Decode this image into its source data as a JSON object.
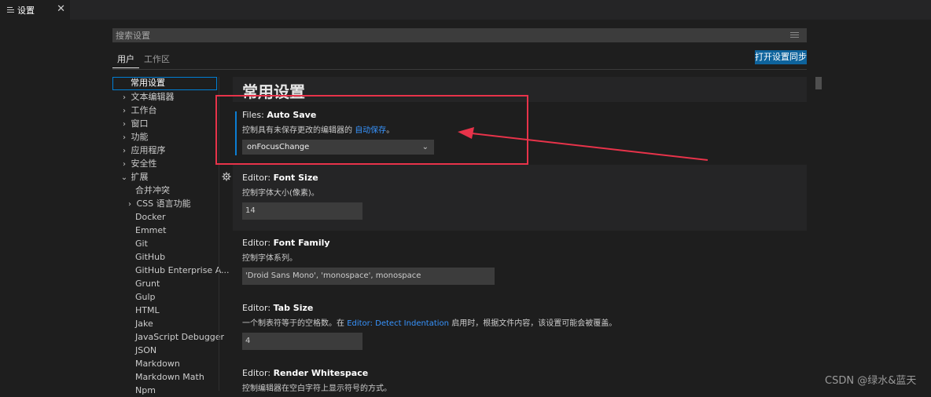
{
  "tab": {
    "title": "设置",
    "icon": "settings-list-icon",
    "close": "✕"
  },
  "search": {
    "placeholder": "搜索设置",
    "filter_icon": "filter-list-icon"
  },
  "scope_tabs": [
    "用户",
    "工作区"
  ],
  "sync_button": "打开设置同步",
  "toc": [
    {
      "label": "常用设置",
      "selected": true
    },
    {
      "label": "文本编辑器",
      "chevron": "›"
    },
    {
      "label": "工作台",
      "chevron": "›"
    },
    {
      "label": "窗口",
      "chevron": "›"
    },
    {
      "label": "功能",
      "chevron": "›"
    },
    {
      "label": "应用程序",
      "chevron": "›"
    },
    {
      "label": "安全性",
      "chevron": "›"
    },
    {
      "label": "扩展",
      "chevron": "⌄"
    },
    {
      "label": "合并冲突"
    },
    {
      "label": "CSS 语言功能",
      "chevron": "›"
    },
    {
      "label": "Docker"
    },
    {
      "label": "Emmet"
    },
    {
      "label": "Git"
    },
    {
      "label": "GitHub"
    },
    {
      "label": "GitHub Enterprise A..."
    },
    {
      "label": "Grunt"
    },
    {
      "label": "Gulp"
    },
    {
      "label": "HTML"
    },
    {
      "label": "Jake"
    },
    {
      "label": "JavaScript Debugger"
    },
    {
      "label": "JSON"
    },
    {
      "label": "Markdown"
    },
    {
      "label": "Markdown Math"
    },
    {
      "label": "Npm"
    }
  ],
  "section_title": "常用设置",
  "settings": {
    "auto_save": {
      "category": "Files:",
      "name": "Auto Save",
      "desc_prefix": "控制具有未保存更改的编辑器的",
      "desc_link": "自动保存",
      "desc_suffix": "。",
      "value": "onFocusChange"
    },
    "font_size": {
      "category": "Editor:",
      "name": "Font Size",
      "desc": "控制字体大小(像素)。",
      "value": "14"
    },
    "font_family": {
      "category": "Editor:",
      "name": "Font Family",
      "desc": "控制字体系列。",
      "value": "'Droid Sans Mono', 'monospace', monospace"
    },
    "tab_size": {
      "category": "Editor:",
      "name": "Tab Size",
      "desc_prefix": "一个制表符等于的空格数。在",
      "desc_link": "Editor: Detect Indentation",
      "desc_suffix": "启用时，根据文件内容，该设置可能会被覆盖。",
      "value": "4"
    },
    "render_whitespace": {
      "category": "Editor:",
      "name": "Render Whitespace",
      "desc": "控制编辑器在空白字符上显示符号的方式。"
    }
  },
  "watermark": "CSDN @绿水&蓝天",
  "colors": {
    "accent": "#0e639c",
    "link": "#3794ff",
    "annotation": "#e8334a"
  }
}
